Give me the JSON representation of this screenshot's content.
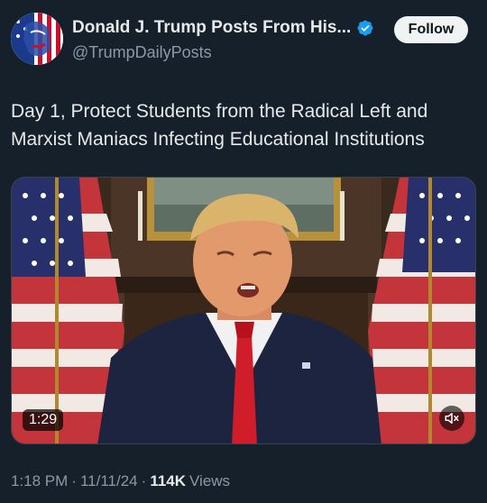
{
  "author": {
    "display_name": "Donald J. Trump Posts From His...",
    "handle": "@TrumpDailyPosts",
    "verified": true,
    "verified_color": "#1d9bf0"
  },
  "actions": {
    "follow_label": "Follow"
  },
  "post": {
    "text": "Day 1, Protect Students from the Radical Left and\nMarxist Maniacs Infecting Educational Institutions"
  },
  "video": {
    "duration": "1:29",
    "muted": true
  },
  "meta": {
    "time": "1:18 PM",
    "separator": "·",
    "date": "11/11/24",
    "views_count": "114K",
    "views_label": "Views"
  },
  "theme": {
    "background": "#15202b",
    "text": "#e7e9ea",
    "secondary_text": "#8b98a5"
  }
}
